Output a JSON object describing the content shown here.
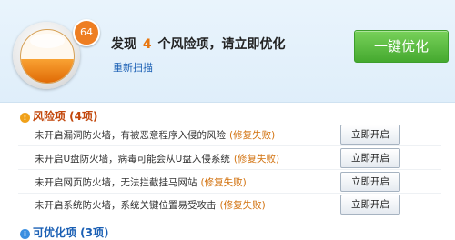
{
  "summary": {
    "score": "64",
    "headline_prefix": "发现",
    "risk_count": "4",
    "headline_suffix": "个风险项，请立即优化",
    "rescan_label": "重新扫描",
    "optimize_label": "一键优化",
    "gauge_level": 0.45
  },
  "risk_section": {
    "title": "风险项 (4项)",
    "items": [
      {
        "text": "未开启漏洞防火墙，有被恶意程序入侵的风险",
        "status": "(修复失败)",
        "action": "立即开启"
      },
      {
        "text": "未开启U盘防火墙，病毒可能会从U盘入侵系统",
        "status": "(修复失败)",
        "action": "立即开启"
      },
      {
        "text": "未开启网页防火墙，无法拦截挂马网站",
        "status": "(修复失败)",
        "action": "立即开启"
      },
      {
        "text": "未开启系统防火墙，系统关键位置易受攻击",
        "status": "(修复失败)",
        "action": "立即开启"
      }
    ]
  },
  "optimizable_section": {
    "title": "可优化项 (3项)"
  },
  "colors": {
    "accent_orange": "#e8760f",
    "optimize_green": "#45a92f",
    "link_blue": "#1a5fb4"
  }
}
